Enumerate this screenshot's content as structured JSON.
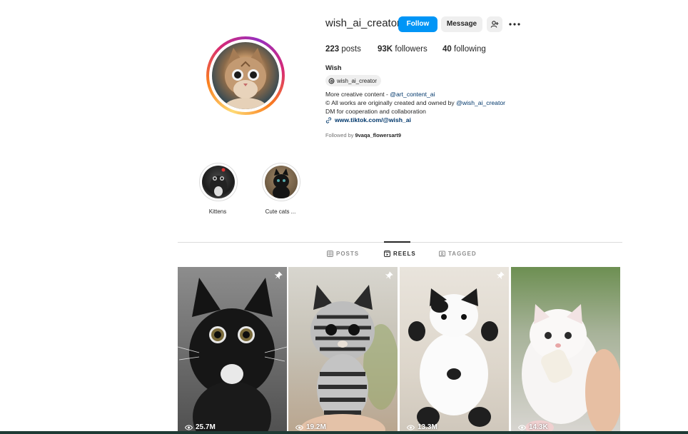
{
  "profile": {
    "username": "wish_ai_creator",
    "follow_label": "Follow",
    "message_label": "Message",
    "posts_count": "223",
    "posts_label": "posts",
    "followers_count": "93K",
    "followers_label": "followers",
    "following_count": "40",
    "following_label": "following",
    "full_name": "Wish",
    "threads_handle": "wish_ai_creator",
    "bio_line1_prefix": "More creative content - ",
    "bio_line1_link": "@art_content_ai",
    "bio_line2_prefix": "© All works are originally created and owned by ",
    "bio_line2_link": "@wish_ai_creator",
    "bio_line3": "DM for cooperation and collaboration",
    "website": "www.tiktok.com/@wish_ai",
    "followed_by_prefix": "Followed by ",
    "followed_by_names": "9vaqa_flowersart9"
  },
  "highlights": [
    {
      "label": "Kittens"
    },
    {
      "label": "Cute cats ..."
    }
  ],
  "tabs": [
    {
      "label": "POSTS",
      "icon": "grid-icon",
      "active": false
    },
    {
      "label": "REELS",
      "icon": "reels-icon",
      "active": true
    },
    {
      "label": "TAGGED",
      "icon": "tagged-icon",
      "active": false
    }
  ],
  "reels": [
    {
      "views": "25.7M",
      "pinned": true,
      "subject": "black-white-kitten"
    },
    {
      "views": "19.2M",
      "pinned": true,
      "subject": "striped-kitten"
    },
    {
      "views": "13.3M",
      "pinned": true,
      "subject": "calico-kitten"
    },
    {
      "views": "14.3K",
      "pinned": false,
      "subject": "white-kitten-bottle"
    }
  ],
  "colors": {
    "follow_button": "#0095f6",
    "secondary_button": "#efefef",
    "link": "#00376b",
    "muted": "#737373"
  }
}
